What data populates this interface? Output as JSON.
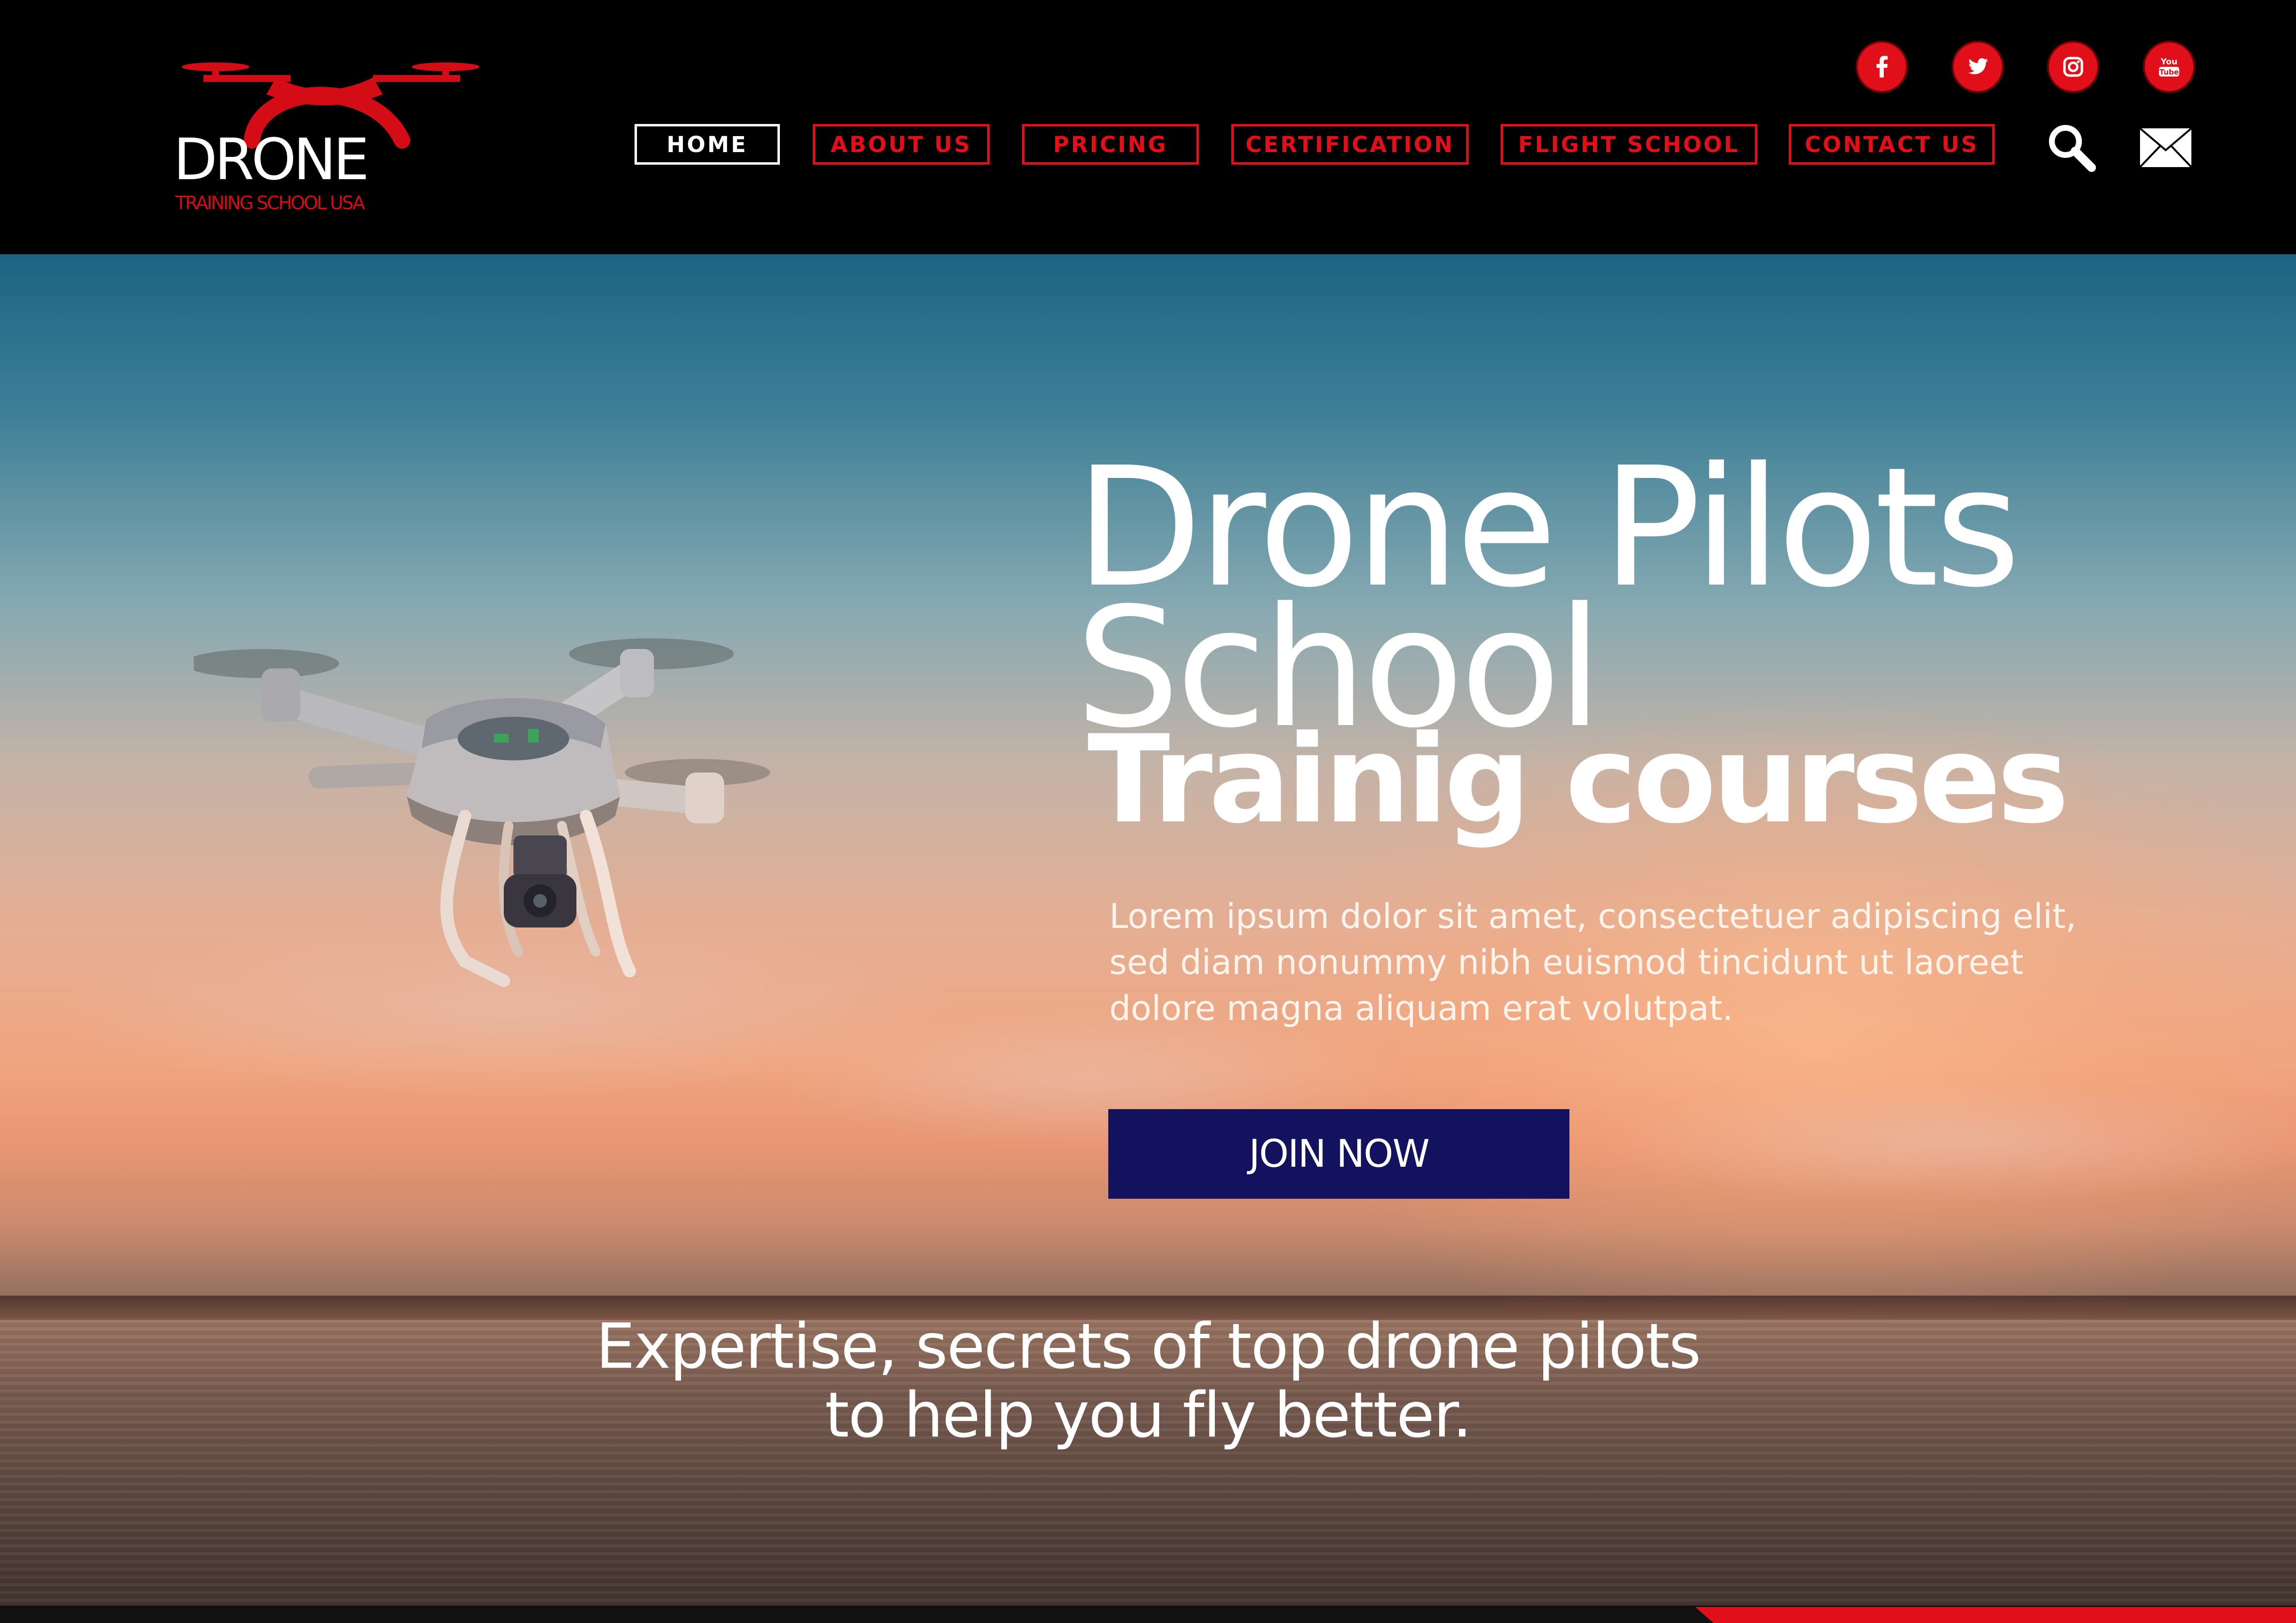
{
  "logo": {
    "word": "DRONE",
    "subtitle": "TRAINING SCHOOL USA",
    "brand_color": "#d40c16"
  },
  "nav": {
    "items": [
      {
        "label": "HOME",
        "active": true
      },
      {
        "label": "ABOUT US",
        "active": false
      },
      {
        "label": "PRICING",
        "active": false
      },
      {
        "label": "CERTIFICATION",
        "active": false
      },
      {
        "label": "FLIGHT SCHOOL",
        "active": false
      },
      {
        "label": "CONTACT US",
        "active": false
      }
    ],
    "accent_color": "#e20f19",
    "active_color": "#ffffff"
  },
  "social": {
    "icons": [
      "facebook-icon",
      "twitter-icon",
      "instagram-icon",
      "youtube-icon"
    ],
    "youtube_text": "You Tube"
  },
  "tools": {
    "icons": [
      "search-icon",
      "mail-icon"
    ]
  },
  "hero": {
    "title_line1": "Drone Pilots",
    "title_line2": "School",
    "subtitle": "Trainig courses",
    "body": "Lorem ipsum dolor sit amet, consectetuer adipiscing elit, sed diam nonummy nibh euismod tincidunt ut laoreet dolore magna aliquam erat volutpat.",
    "cta_label": "JOIN NOW",
    "cta_color": "#12125e",
    "tagline_line1": "Expertise,  secrets of top drone pilots",
    "tagline_line2": "to help you fly better."
  }
}
